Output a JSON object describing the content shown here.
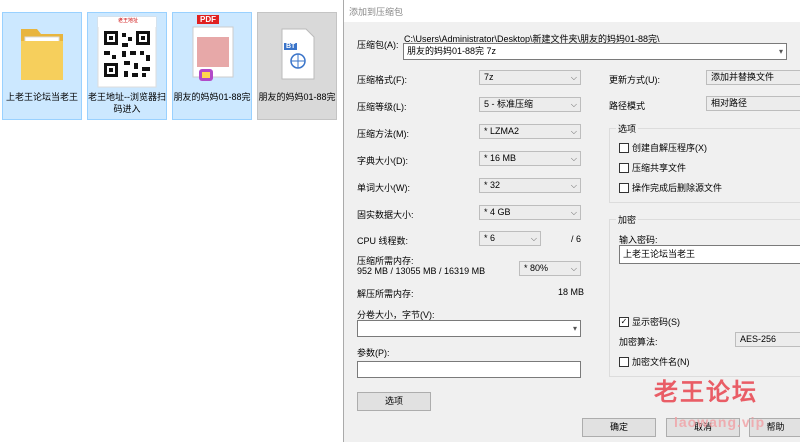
{
  "files": [
    {
      "name": "上老王论坛当老王",
      "icon": "folder-icon"
    },
    {
      "name": "老王地址--浏览器扫码进入",
      "icon": "qr-code-image",
      "thumb_text": "老王地址"
    },
    {
      "name": "朋友的妈妈01-88完",
      "icon": "pdf-file-icon",
      "badge": "PDF"
    },
    {
      "name": "朋友的妈妈01-88完",
      "icon": "bt-torrent-icon",
      "badge": "BT"
    }
  ],
  "dialog": {
    "title": "添加到压缩包",
    "archive_label": "压缩包(A):",
    "archive_path": "C:\\Users\\Administrator\\Desktop\\新建文件夹\\朋友的妈妈01-88完\\",
    "archive_name": "朋友的妈妈01-88完 7z",
    "format_label": "压缩格式(F):",
    "format_value": "7z",
    "level_label": "压缩等级(L):",
    "level_value": "5 - 标准压缩",
    "method_label": "压缩方法(M):",
    "method_value": "* LZMA2",
    "dict_label": "字典大小(D):",
    "dict_value": "* 16 MB",
    "word_label": "单词大小(W):",
    "word_value": "* 32",
    "solid_label": "固实数据大小:",
    "solid_value": "* 4 GB",
    "threads_label": "CPU 线程数:",
    "threads_value": "* 6",
    "threads_max": "/ 6",
    "mem_label": "压缩所需内存:",
    "mem_detail": "952 MB / 13055 MB / 16319 MB",
    "mem_value": "* 80%",
    "decomp_label": "解压所需内存:",
    "decomp_value": "18 MB",
    "split_label": "分卷大小，字节(V):",
    "split_value": "",
    "params_label": "参数(P):",
    "params_value": "",
    "options_button": "选项",
    "update_label": "更新方式(U):",
    "update_value": "添加并替换文件",
    "path_label": "路径模式",
    "path_value": "相对路径",
    "options_group": "选项",
    "opt_sfx": "创建自解压程序(X)",
    "opt_shared": "压缩共享文件",
    "opt_delete": "操作完成后删除源文件",
    "encrypt_group": "加密",
    "password_label": "输入密码:",
    "password_value": "上老王论坛当老王",
    "show_password": "显示密码(S)",
    "enc_method_label": "加密算法:",
    "enc_method_value": "AES-256",
    "enc_names": "加密文件名(N)",
    "ok_button": "确定",
    "cancel_button": "取消",
    "help_button": "帮助"
  },
  "watermark": {
    "text": "老王论坛",
    "sub": "laowang.vip"
  },
  "colors": {
    "selection": "#cce8ff",
    "dialog_bg": "#f0f0f0",
    "watermark": "#e8444f"
  }
}
